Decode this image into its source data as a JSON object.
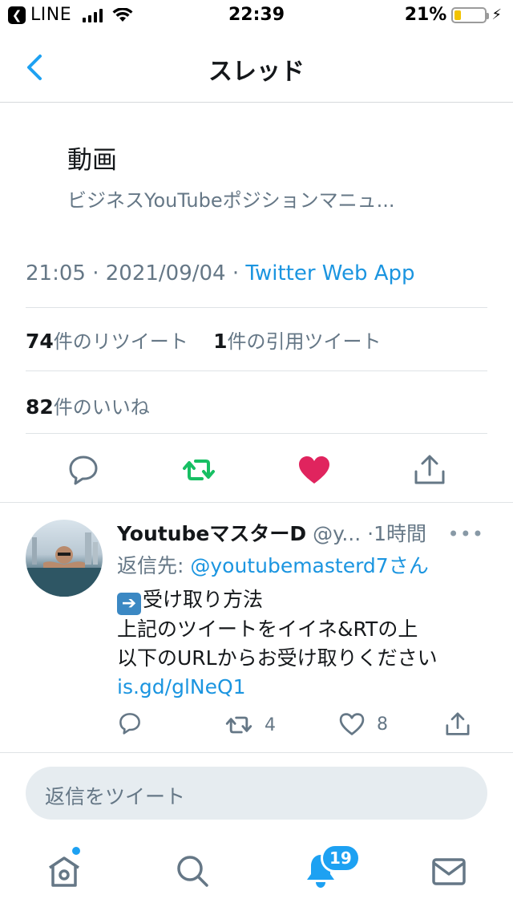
{
  "status_bar": {
    "back_app_label": "LINE",
    "time": "22:39",
    "battery_percent": "21%",
    "battery_level": 0.21,
    "battery_color": "#f2c300"
  },
  "header": {
    "back_icon": "chevron-left-icon",
    "title": "スレッド"
  },
  "tweet": {
    "card_title": "動画",
    "card_subtitle": "ビジネスYouTubeポジションマニュ...",
    "time": "21:05",
    "date": "2021/09/04",
    "separator": "·",
    "source": "Twitter Web App",
    "retweets_count": "74",
    "retweets_label": "件のリツイート",
    "quotes_count": "1",
    "quotes_label": "件の引用ツイート",
    "likes_count": "82",
    "likes_label": "件のいいね",
    "actions": [
      {
        "icon": "reply-icon"
      },
      {
        "icon": "retweet-icon",
        "active": true,
        "color": "#17bf63"
      },
      {
        "icon": "heart-icon",
        "active": true,
        "color": "#e0245e"
      },
      {
        "icon": "share-icon"
      }
    ]
  },
  "reply": {
    "name": "YoutubeマスターD",
    "handle": "@y...",
    "time": "·1時間",
    "more_icon": "more-dots-icon",
    "reply_to_label": "返信先: ",
    "reply_to_user": "@youtubemasterd7さん",
    "emoji": "➡️",
    "line1": "受け取り方法",
    "line2": "上記のツイートをイイネ&RTの上",
    "line3": "以下のURLからお受け取りください",
    "link": "is.gd/glNeQ1",
    "retweet_count": "4",
    "like_count": "8"
  },
  "compose": {
    "placeholder": "返信をツイート"
  },
  "tab_bar": {
    "tabs": [
      {
        "icon": "home-icon"
      },
      {
        "icon": "search-icon"
      },
      {
        "icon": "bell-icon",
        "active": true
      },
      {
        "icon": "mail-icon"
      }
    ],
    "notification_badge": "19",
    "accent_color": "#1da1f2"
  }
}
